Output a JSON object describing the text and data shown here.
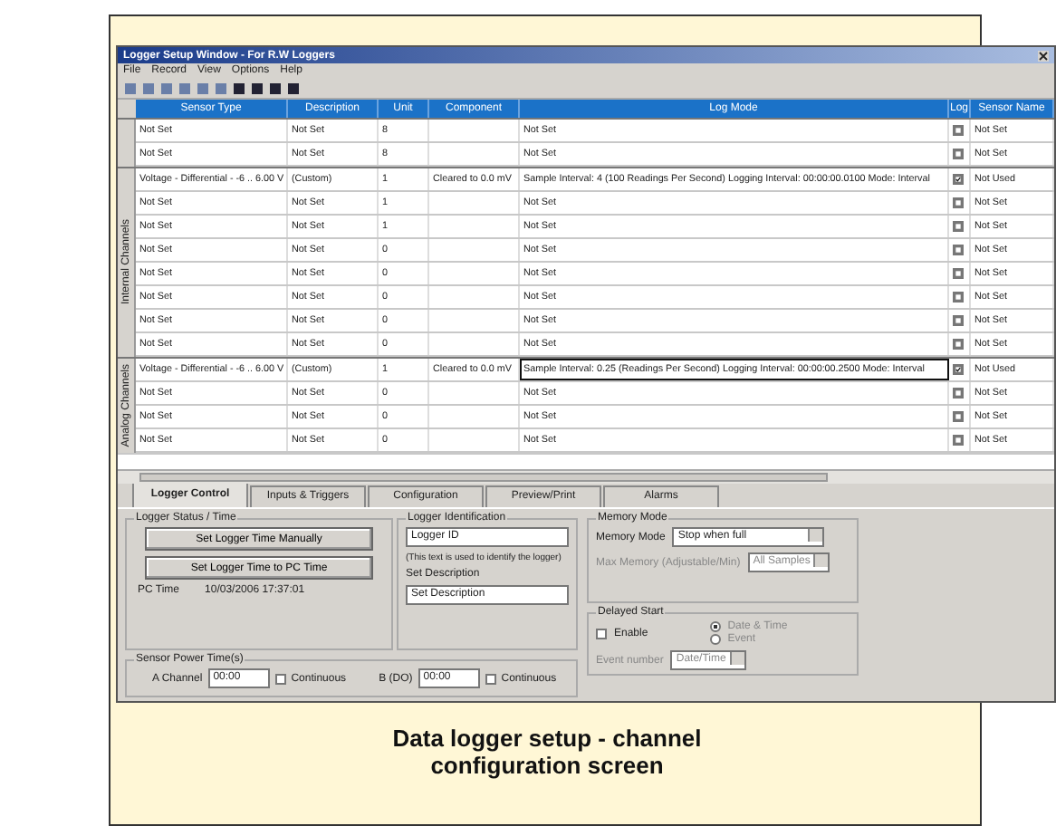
{
  "window": {
    "title": "Logger Setup Window - For R.W Loggers"
  },
  "menu": [
    "File",
    "Record",
    "View",
    "Options",
    "Help"
  ],
  "grid": {
    "columns": [
      "Sensor Type",
      "Description",
      "Unit",
      "Component",
      "Log Mode",
      "Log",
      "Sensor Name"
    ],
    "sections": [
      {
        "rows": [
          {
            "cells": [
              "Not Set",
              "Not Set",
              "8",
              "",
              "Not Set"
            ],
            "log_checked": false,
            "name": "Not Set",
            "outlined": false
          },
          {
            "cells": [
              "Not Set",
              "Not Set",
              "8",
              "",
              "Not Set"
            ],
            "log_checked": false,
            "name": "Not Set",
            "outlined": false
          }
        ]
      },
      {
        "label": "Internal Channels",
        "rows": [
          {
            "cells": [
              "Voltage - Differential - -6 .. 6.00 V",
              "(Custom)",
              "1",
              "Cleared to 0.0 mV",
              "Sample Interval: 4 (100 Readings Per Second) Logging Interval: 00:00:00.0100 Mode: Interval"
            ],
            "log_checked": true,
            "name": "Not Used",
            "outlined": false
          },
          {
            "cells": [
              "Not Set",
              "Not Set",
              "1",
              "",
              "Not Set"
            ],
            "log_checked": false,
            "name": "Not Set",
            "outlined": false
          },
          {
            "cells": [
              "Not Set",
              "Not Set",
              "1",
              "",
              "Not Set"
            ],
            "log_checked": false,
            "name": "Not Set",
            "outlined": false
          },
          {
            "cells": [
              "Not Set",
              "Not Set",
              "0",
              "",
              "Not Set"
            ],
            "log_checked": false,
            "name": "Not Set",
            "outlined": false
          },
          {
            "cells": [
              "Not Set",
              "Not Set",
              "0",
              "",
              "Not Set"
            ],
            "log_checked": false,
            "name": "Not Set",
            "outlined": false
          },
          {
            "cells": [
              "Not Set",
              "Not Set",
              "0",
              "",
              "Not Set"
            ],
            "log_checked": false,
            "name": "Not Set",
            "outlined": false
          },
          {
            "cells": [
              "Not Set",
              "Not Set",
              "0",
              "",
              "Not Set"
            ],
            "log_checked": false,
            "name": "Not Set",
            "outlined": false
          },
          {
            "cells": [
              "Not Set",
              "Not Set",
              "0",
              "",
              "Not Set"
            ],
            "log_checked": false,
            "name": "Not Set",
            "outlined": false
          }
        ]
      },
      {
        "label": "Analog Channels",
        "rows": [
          {
            "cells": [
              "Voltage - Differential - -6 .. 6.00 V",
              "(Custom)",
              "1",
              "Cleared to 0.0 mV",
              "Sample Interval: 0.25 (Readings Per Second) Logging Interval: 00:00:00.2500 Mode: Interval"
            ],
            "log_checked": true,
            "name": "Not Used",
            "outlined": true
          },
          {
            "cells": [
              "Not Set",
              "Not Set",
              "0",
              "",
              "Not Set"
            ],
            "log_checked": false,
            "name": "Not Set",
            "outlined": false
          },
          {
            "cells": [
              "Not Set",
              "Not Set",
              "0",
              "",
              "Not Set"
            ],
            "log_checked": false,
            "name": "Not Set",
            "outlined": false
          },
          {
            "cells": [
              "Not Set",
              "Not Set",
              "0",
              "",
              "Not Set"
            ],
            "log_checked": false,
            "name": "Not Set",
            "outlined": false
          }
        ]
      }
    ]
  },
  "tabs": [
    {
      "label": "Logger Control",
      "selected": true
    },
    {
      "label": "Inputs & Triggers",
      "selected": false
    },
    {
      "label": "Configuration",
      "selected": false
    },
    {
      "label": "Preview/Print",
      "selected": false
    },
    {
      "label": "Alarms",
      "selected": false
    }
  ],
  "logger_status": {
    "title": "Logger Status / Time",
    "buttons": [
      "Set Logger Time Manually",
      "Set Logger Time to PC Time"
    ],
    "pc_time_label": "PC Time",
    "pc_time": "10/03/2006 17:37:01"
  },
  "identification": {
    "title": "Logger Identification",
    "id_value": "Logger ID",
    "id_hint": "(This text is used to identify the logger)",
    "description_title": "Set Description",
    "description_value": "Set Description"
  },
  "memory": {
    "title": "Memory Mode",
    "mode_label": "Memory Mode",
    "mode_value": "Stop when full",
    "max_label": "Max Memory (Adjustable/Min)",
    "max_value": "All Samples"
  },
  "delayed_start": {
    "title": "Delayed Start",
    "enable_label": "Enable",
    "enabled": false,
    "options": [
      {
        "label": "Date & Time",
        "selected": true
      },
      {
        "label": "Event",
        "selected": false
      }
    ],
    "event_label": "Event number",
    "event_value": "Date/Time"
  },
  "sensor_power": {
    "title": "Sensor Power Time(s)",
    "items": [
      {
        "label": "A Channel",
        "value": "00:00",
        "continuous_label": "Continuous",
        "continuous": false
      },
      {
        "label": "B (DO)",
        "value": "00:00",
        "continuous_label": "Continuous",
        "continuous": false
      }
    ]
  },
  "caption": [
    "Data logger setup - channel",
    "configuration screen"
  ]
}
